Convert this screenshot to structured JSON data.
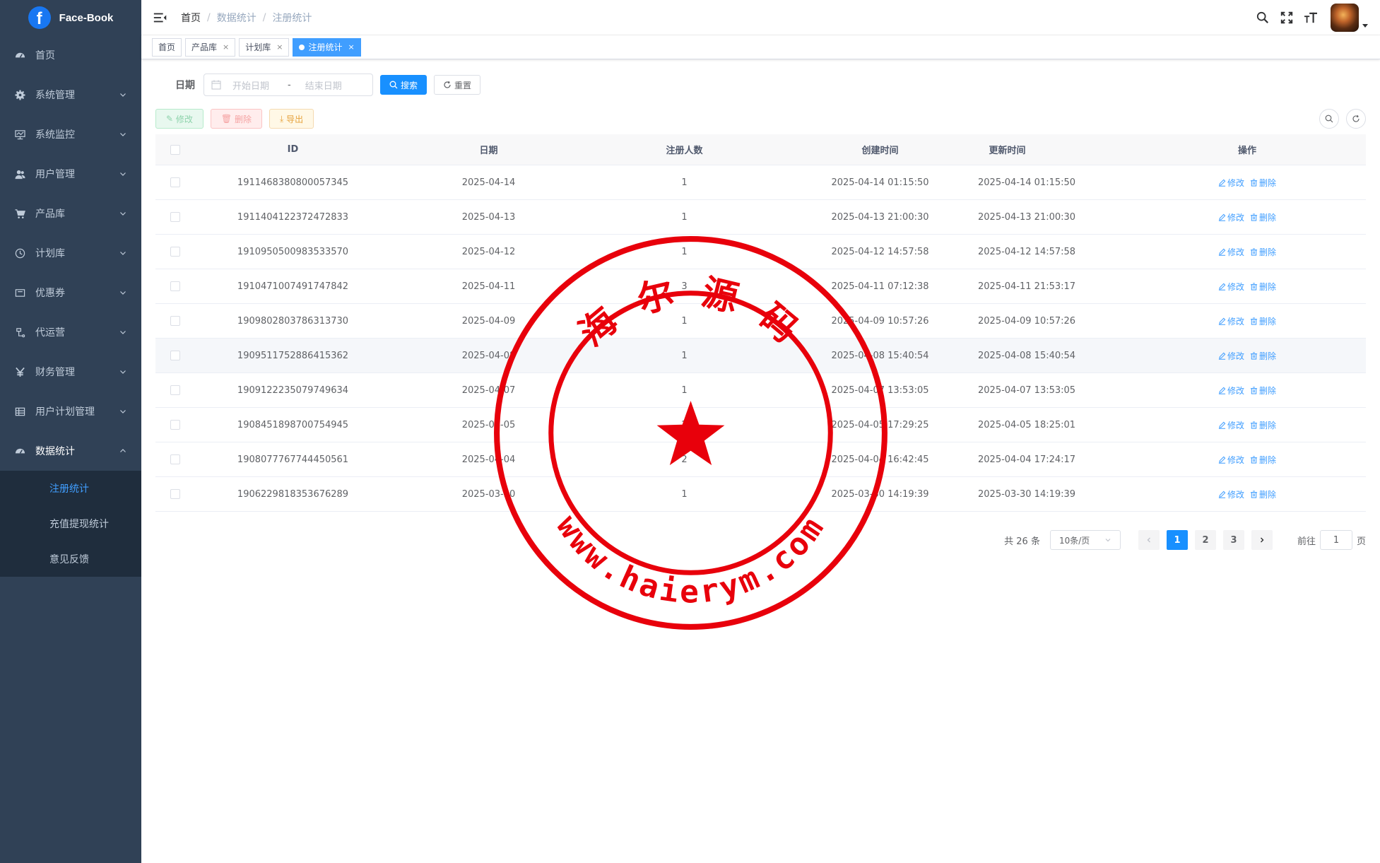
{
  "app": {
    "title": "Face-Book",
    "logo_letter": "f"
  },
  "sidebar": {
    "items": [
      {
        "label": "首页",
        "icon": "dashboard-icon"
      },
      {
        "label": "系统管理",
        "icon": "gear-icon"
      },
      {
        "label": "系统监控",
        "icon": "monitor-icon"
      },
      {
        "label": "用户管理",
        "icon": "user-icon"
      },
      {
        "label": "产品库",
        "icon": "cart-icon"
      },
      {
        "label": "计划库",
        "icon": "clock-icon"
      },
      {
        "label": "优惠券",
        "icon": "coupon-icon"
      },
      {
        "label": "代运营",
        "icon": "operate-icon"
      },
      {
        "label": "财务管理",
        "icon": "yen-icon"
      },
      {
        "label": "用户计划管理",
        "icon": "grid-icon"
      },
      {
        "label": "数据统计",
        "icon": "dashboard-icon"
      }
    ],
    "submenu": [
      {
        "label": "注册统计"
      },
      {
        "label": "充值提现统计"
      },
      {
        "label": "意见反馈"
      }
    ]
  },
  "breadcrumb": [
    "首页",
    "数据统计",
    "注册统计"
  ],
  "tags": [
    {
      "label": "首页"
    },
    {
      "label": "产品库"
    },
    {
      "label": "计划库"
    },
    {
      "label": "注册统计"
    }
  ],
  "search": {
    "date_label": "日期",
    "start_placeholder": "开始日期",
    "range_separator": "-",
    "end_placeholder": "结束日期",
    "search_label": "搜索",
    "reset_label": "重置"
  },
  "toolbar": {
    "edit_label": "修改",
    "delete_label": "删除",
    "export_label": "导出"
  },
  "table": {
    "headers": {
      "id": "ID",
      "date": "日期",
      "count": "注册人数",
      "created": "创建时间",
      "updated": "更新时间",
      "actions": "操作"
    },
    "edit_label": "修改",
    "delete_label": "删除",
    "rows": [
      {
        "id": "1911468380800057345",
        "date": "2025-04-14",
        "count": "1",
        "created": "2025-04-14 01:15:50",
        "updated": "2025-04-14 01:15:50"
      },
      {
        "id": "1911404122372472833",
        "date": "2025-04-13",
        "count": "1",
        "created": "2025-04-13 21:00:30",
        "updated": "2025-04-13 21:00:30"
      },
      {
        "id": "1910950500983533570",
        "date": "2025-04-12",
        "count": "1",
        "created": "2025-04-12 14:57:58",
        "updated": "2025-04-12 14:57:58"
      },
      {
        "id": "1910471007491747842",
        "date": "2025-04-11",
        "count": "3",
        "created": "2025-04-11 07:12:38",
        "updated": "2025-04-11 21:53:17"
      },
      {
        "id": "1909802803786313730",
        "date": "2025-04-09",
        "count": "1",
        "created": "2025-04-09 10:57:26",
        "updated": "2025-04-09 10:57:26"
      },
      {
        "id": "1909511752886415362",
        "date": "2025-04-08",
        "count": "1",
        "created": "2025-04-08 15:40:54",
        "updated": "2025-04-08 15:40:54"
      },
      {
        "id": "1909122235079749634",
        "date": "2025-04-07",
        "count": "1",
        "created": "2025-04-07 13:53:05",
        "updated": "2025-04-07 13:53:05"
      },
      {
        "id": "1908451898700754945",
        "date": "2025-04-05",
        "count": "2",
        "created": "2025-04-05 17:29:25",
        "updated": "2025-04-05 18:25:01"
      },
      {
        "id": "1908077767744450561",
        "date": "2025-04-04",
        "count": "2",
        "created": "2025-04-04 16:42:45",
        "updated": "2025-04-04 17:24:17"
      },
      {
        "id": "1906229818353676289",
        "date": "2025-03-30",
        "count": "1",
        "created": "2025-03-30 14:19:39",
        "updated": "2025-03-30 14:19:39"
      }
    ]
  },
  "pagination": {
    "total_text": "共 26 条",
    "page_size": "10条/页",
    "pages": [
      "1",
      "2",
      "3"
    ],
    "current": "1",
    "goto_label": "前往",
    "goto_value": "1",
    "page_unit": "页"
  },
  "watermark": {
    "top_text": "海 尔 源 码",
    "bottom_text": "www.haierym.com",
    "color": "#e8000b"
  },
  "colors": {
    "sidebar_bg": "#304156",
    "submenu_bg": "#1f2d3d",
    "accent": "#1890ff"
  }
}
